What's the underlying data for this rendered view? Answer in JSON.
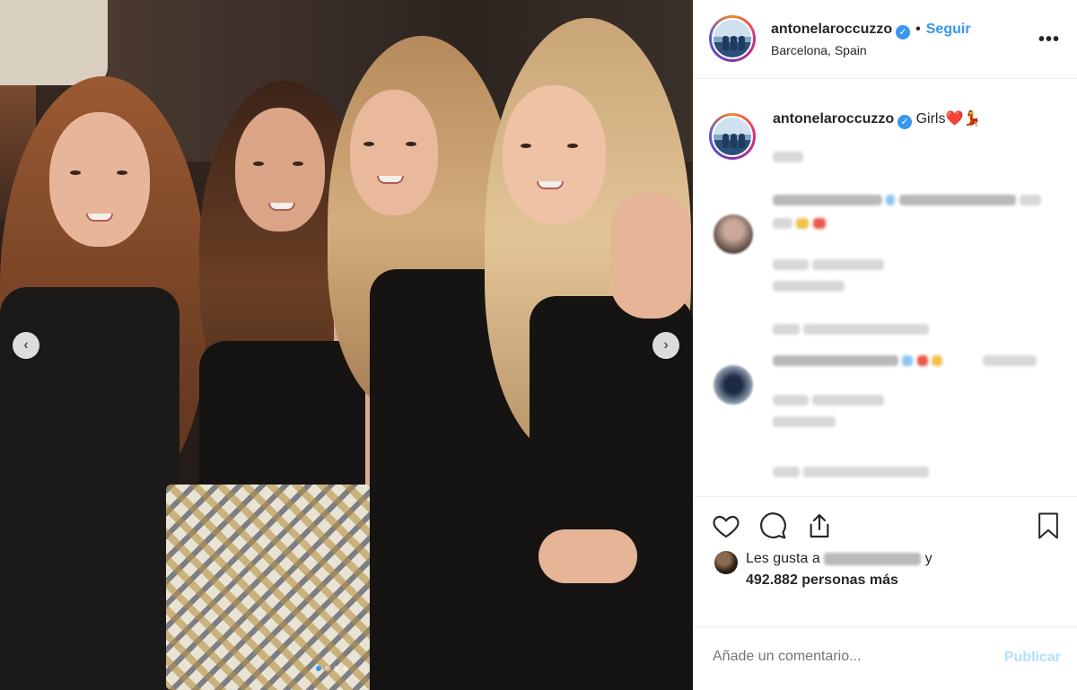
{
  "header": {
    "username": "antonelaroccuzzo",
    "follow_label": "Seguir",
    "separator": "•",
    "location": "Barcelona, Spain",
    "more_label": "•••"
  },
  "caption": {
    "username": "antonelaroccuzzo",
    "text": "Girls❤️💃"
  },
  "likes": {
    "prefix": "Les gusta a",
    "suffix": "y",
    "count_text": "492.882 personas más"
  },
  "comment_box": {
    "placeholder": "Añade un comentario...",
    "publish_label": "Publicar"
  },
  "icons": {
    "like": "heart-icon",
    "comment": "comment-icon",
    "share": "share-icon",
    "save": "bookmark-icon",
    "prev": "chevron-left-icon",
    "next": "chevron-right-icon",
    "verified": "verified-badge-icon"
  },
  "colors": {
    "accent": "#3897f0",
    "publish_disabled": "#b2dffc",
    "border": "#efefef",
    "text": "#262626"
  },
  "carousel": {
    "prev_glyph": "‹",
    "next_glyph": "›",
    "verified_glyph": "✓"
  }
}
